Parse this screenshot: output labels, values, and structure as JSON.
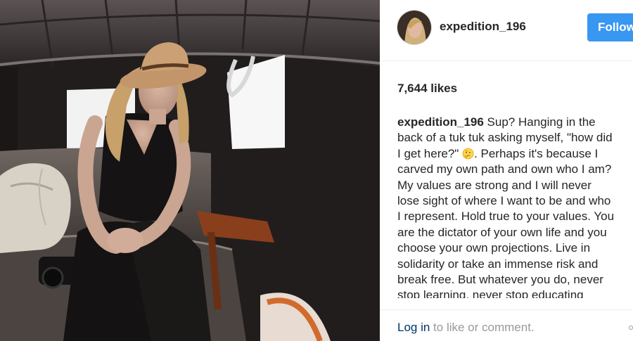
{
  "post": {
    "username": "expedition_196",
    "follow_label": "Follow",
    "likes": "7,644 likes",
    "caption": {
      "user": "expedition_196",
      "lines": [
        " Sup? Hanging in the",
        "back of a tuk tuk asking myself, \"how did",
        "I get here?\"",
        ". Perhaps it's because I",
        "carved my own path and own who I am?",
        "My values are strong and I will never",
        "lose sight of where I want to be and who",
        "I represent. Hold true to your values. You",
        "are the dictator of your own life and you",
        "choose your own projections. Live in",
        "solidarity or take an immense risk and",
        "break free. But whatever you do, never",
        "stop learning, never stop educating"
      ],
      "emoji": "thinking-face-icon"
    },
    "footer": {
      "login_label": "Log in",
      "rest": " to like or comment."
    }
  },
  "colors": {
    "follow_bg": "#3897f0",
    "link": "#003569",
    "muted": "#999999"
  }
}
